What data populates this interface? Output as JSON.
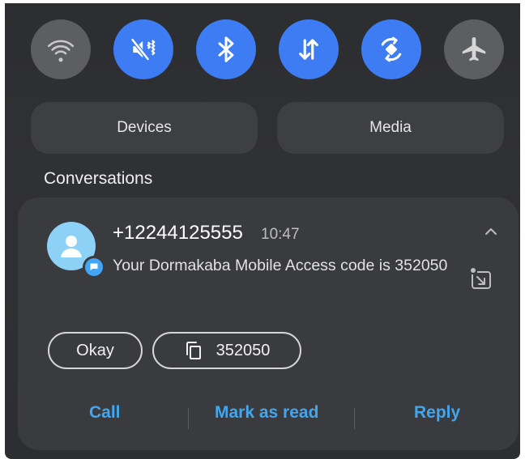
{
  "quick_settings": {
    "toggles": [
      {
        "name": "wifi-icon",
        "state": "off"
      },
      {
        "name": "vibrate-icon",
        "state": "on"
      },
      {
        "name": "bluetooth-icon",
        "state": "on"
      },
      {
        "name": "mobile-data-icon",
        "state": "on"
      },
      {
        "name": "auto-rotate-icon",
        "state": "on"
      },
      {
        "name": "airplane-icon",
        "state": "off"
      }
    ],
    "devices_label": "Devices",
    "media_label": "Media"
  },
  "section_title": "Conversations",
  "notification": {
    "sender": "+12244125555",
    "time": "10:47",
    "message": "Your Dormakaba Mobile Access code is 352050",
    "chips": {
      "okay": "Okay",
      "copy_code": "352050"
    },
    "actions": {
      "call": "Call",
      "mark_as_read": "Mark as read",
      "reply": "Reply"
    }
  },
  "colors": {
    "toggle_on": "#3d7cf2",
    "toggle_off": "#5c5e62",
    "action_text": "#43a6ee",
    "card_bg": "#3a3b3e",
    "avatar_bg": "#8dd2f6"
  }
}
